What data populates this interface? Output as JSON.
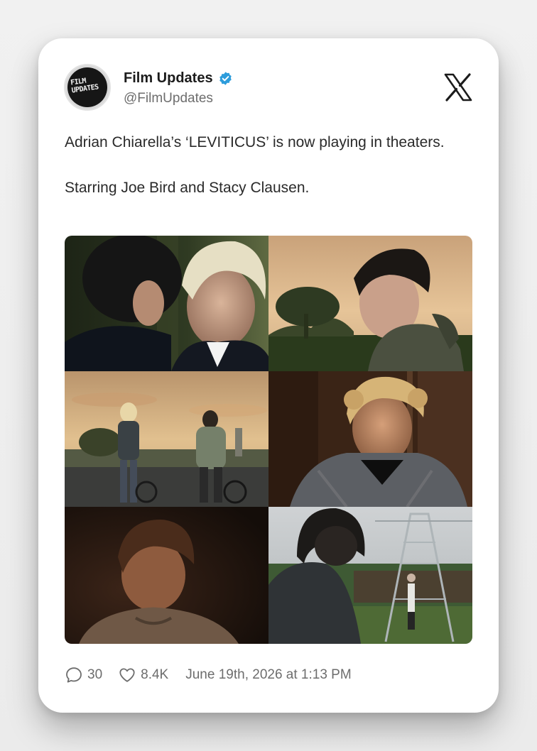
{
  "author": {
    "name": "Film Updates",
    "handle": "@FilmUpdates",
    "avatar_text": [
      "FILM",
      "UPDATES"
    ],
    "verified": true
  },
  "tweet": {
    "paragraph1": "Adrian Chiarella’s ‘LEVITICUS’ is now playing in theaters.",
    "paragraph2": "Starring Joe Bird and Stacy Clausen."
  },
  "media": {
    "count": 6,
    "frames": [
      "two-men-close-up-frame",
      "boy-in-field-sunset-frame",
      "boys-walking-bikes-frame",
      "curly-blond-boy-frame",
      "dim-smiling-boy-frame",
      "back-view-power-tower-frame"
    ]
  },
  "stats": {
    "replies": "30",
    "likes": "8.4K",
    "timestamp": "June 19th, 2026 at 1:13 PM"
  },
  "icons": {
    "reply": "comment-bubble-icon",
    "like": "heart-icon",
    "brand": "x-logo-icon",
    "verified": "verified-badge-icon"
  },
  "colors": {
    "verified": "#2d9cdb",
    "text": "#2a2a2a",
    "muted": "#6d6d6d",
    "card": "#ffffff"
  }
}
